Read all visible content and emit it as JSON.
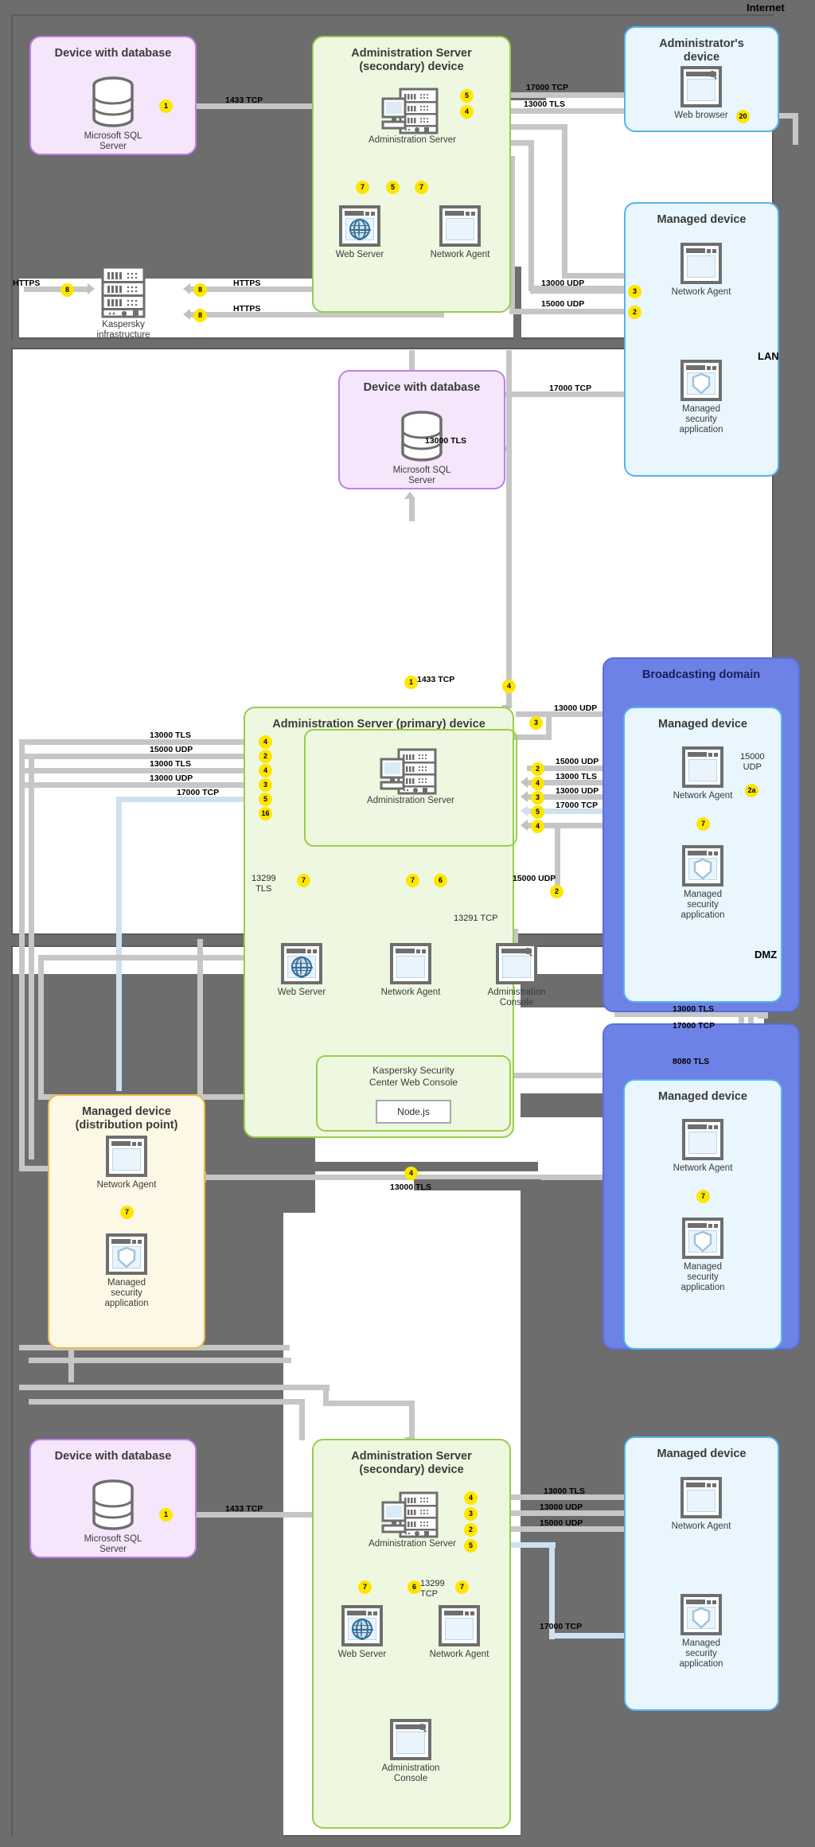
{
  "zones": [
    {
      "id": "internet",
      "label": "Internet"
    },
    {
      "id": "lan",
      "label": "LAN"
    },
    {
      "id": "dmz",
      "label": "DMZ"
    }
  ],
  "internet_section": {
    "db_box": {
      "title": "Device with database",
      "component": "Microsoft SQL Server"
    },
    "secondary_box": {
      "title": "Administration Server\n(secondary) device",
      "components": [
        "Administration Server",
        "Web Server",
        "Network Agent"
      ]
    },
    "admin_device_box": {
      "title": "Administrator's\ndevice",
      "components": [
        "Web browser"
      ]
    },
    "managed_device_box": {
      "title": "Managed device",
      "components": [
        "Network Agent",
        "Managed security\napplication"
      ]
    },
    "kaspersky_infra": {
      "caption": "Kaspersky\ninfrastructure"
    },
    "labels": [
      "1433 TCP",
      "17000 TCP",
      "13000 TLS",
      "HTTPS",
      "HTTPS",
      "HTTPS",
      "13000 UDP",
      "15000 UDP",
      "17000 TCP",
      "13000 TLS"
    ],
    "badges": [
      "1",
      "5",
      "4",
      "20",
      "7",
      "5",
      "7",
      "8",
      "8",
      "8",
      "3",
      "2"
    ]
  },
  "lan_section": {
    "db_box": {
      "title": "Device with database",
      "component": "Microsoft SQL Server"
    },
    "primary_box": {
      "title": "Administration Server (primary) device",
      "components": [
        "Administration Server",
        "Web Server",
        "Network Agent",
        "Administration\nConsole"
      ],
      "web_console": {
        "title": "Kaspersky Security\nCenter Web Console",
        "runtime": "Node.js"
      }
    },
    "broadcasting_box": {
      "title": "Broadcasting domain"
    },
    "managed_device_top": {
      "title": "Managed device",
      "components": [
        "Network Agent",
        "Managed security\napplication"
      ]
    },
    "managed_device_bottom": {
      "title": "Managed device",
      "components": [
        "Network Agent",
        "Managed security\napplication"
      ]
    },
    "distribution_point": {
      "title": "Managed device\n(distribution point)",
      "components": [
        "Network Agent",
        "Managed security\napplication"
      ]
    },
    "left_labels": [
      "13000 TLS",
      "15000 UDP",
      "13000 TLS",
      "13000 UDP",
      "17000 TCP"
    ],
    "left_badges": [
      "4",
      "2",
      "4",
      "3",
      "5",
      "16"
    ],
    "right_labels": [
      "13000 UDP",
      "15000 UDP",
      "13000 TLS",
      "13000 UDP",
      "17000 TCP"
    ],
    "right_badges": [
      "3",
      "2",
      "4",
      "3",
      "5",
      "4"
    ],
    "db_label": "1433 TCP",
    "db_badge": "1",
    "top_badge": "4",
    "internal_labels": [
      "13299\nTLS",
      "13291 TCP",
      "15000 UDP",
      "15000\nUDP"
    ],
    "internal_badges": [
      "7",
      "7",
      "6",
      "2",
      "2a",
      "7",
      "7",
      "7"
    ],
    "bottom_labels": [
      "13000 TLS",
      "13000 TLS",
      "17000 TCP",
      "8080 TLS"
    ],
    "bottom_badges": [
      "4"
    ]
  },
  "dmz_section": {
    "db_box": {
      "title": "Device with database",
      "component": "Microsoft SQL Server"
    },
    "secondary_box": {
      "title": "Administration Server\n(secondary) device",
      "components": [
        "Administration Server",
        "Web Server",
        "Network Agent",
        "Administration\nConsole"
      ]
    },
    "managed_device_box": {
      "title": "Managed device",
      "components": [
        "Network Agent",
        "Managed security\napplication"
      ]
    },
    "labels": [
      "1433 TCP",
      "13000 TLS",
      "13000 UDP",
      "15000 UDP",
      "17000 TCP",
      "13299\nTCP"
    ],
    "badges": [
      "1",
      "4",
      "3",
      "2",
      "5",
      "7",
      "6",
      "7"
    ]
  },
  "colors": {
    "database_box": "#f5e6fc",
    "server_box": "#eef8e0",
    "managed_box": "#e9f6fe",
    "distribution_box": "#fdf8e6",
    "broadcasting_box": "#6d82e6",
    "badge": "#ffe600",
    "connector": "#c6c6c6",
    "backdrop": "#6d6d6d"
  }
}
